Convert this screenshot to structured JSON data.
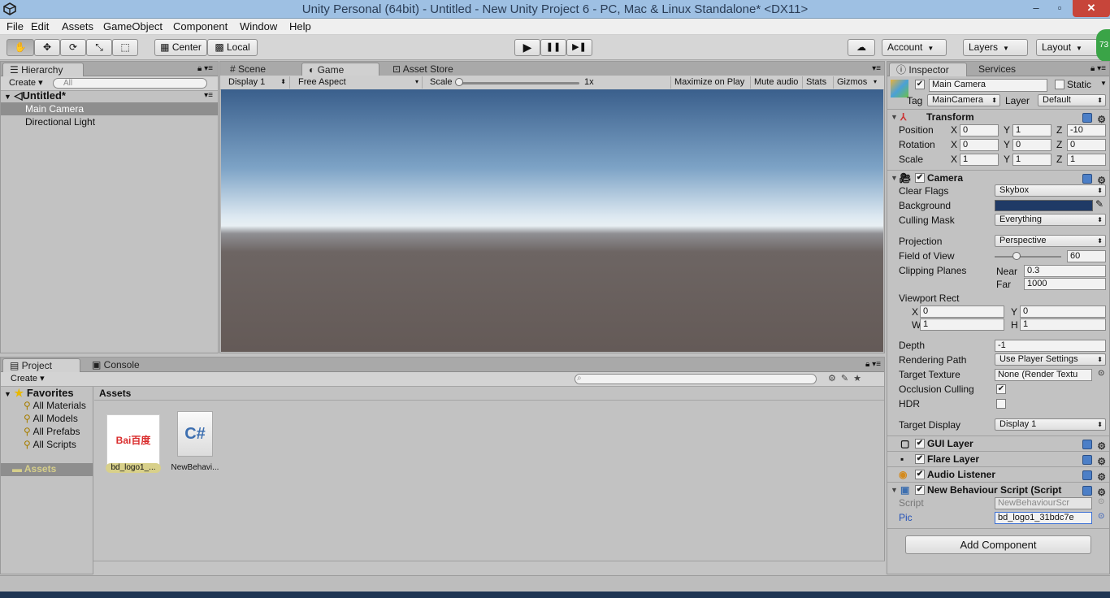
{
  "window": {
    "title": "Unity Personal (64bit) - Untitled - New Unity Project 6 - PC, Mac & Linux Standalone* <DX11>",
    "buttons": [
      "–",
      "▫",
      "✕"
    ]
  },
  "menu": [
    "File",
    "Edit",
    "Assets",
    "GameObject",
    "Component",
    "Window",
    "Help"
  ],
  "toolbar": {
    "transform_tools": [
      "hand-icon",
      "move-icon",
      "rotate-icon",
      "scale-icon",
      "rect-tool-icon"
    ],
    "pivot": "Center",
    "space": "Local",
    "play": "▶",
    "pause": "❚❚",
    "step": "▶❚",
    "account": "Account",
    "layers": "Layers",
    "layout": "Layout",
    "badge": "73"
  },
  "hierarchy": {
    "tab": "Hierarchy",
    "create": "Create",
    "search_placeholder": "All",
    "scene": "Untitled*",
    "items": [
      "Main Camera",
      "Directional Light"
    ],
    "selected": 0
  },
  "center_tabs": [
    "Scene",
    "Game",
    "Asset Store"
  ],
  "game_bar": {
    "display": "Display 1",
    "aspect": "Free Aspect",
    "scale_label": "Scale",
    "scale_value": "1x",
    "maximize": "Maximize on Play",
    "mute": "Mute audio",
    "stats": "Stats",
    "gizmos": "Gizmos"
  },
  "project": {
    "tabs": [
      "Project",
      "Console"
    ],
    "create": "Create",
    "favorites": "Favorites",
    "favorite_items": [
      "All Materials",
      "All Models",
      "All Prefabs",
      "All Scripts"
    ],
    "assets_folder": "Assets",
    "breadcrumb": "Assets",
    "assets": [
      {
        "name": "bd_logo1_...",
        "thumb_text": "Bai百度"
      },
      {
        "name": "NewBehavi...",
        "thumb_text": "C#"
      }
    ]
  },
  "inspector": {
    "tabs": [
      "Inspector",
      "Services"
    ],
    "object_name": "Main Camera",
    "static_label": "Static",
    "tag_label": "Tag",
    "tag_value": "MainCamera",
    "layer_label": "Layer",
    "layer_value": "Default",
    "transform": {
      "title": "Transform",
      "rows": [
        {
          "label": "Position",
          "x": "0",
          "y": "1",
          "z": "-10"
        },
        {
          "label": "Rotation",
          "x": "0",
          "y": "0",
          "z": "0"
        },
        {
          "label": "Scale",
          "x": "1",
          "y": "1",
          "z": "1"
        }
      ]
    },
    "camera": {
      "title": "Camera",
      "clear_flags_label": "Clear Flags",
      "clear_flags": "Skybox",
      "background_label": "Background",
      "background_color": "#1f3a66",
      "culling_mask_label": "Culling Mask",
      "culling_mask": "Everything",
      "projection_label": "Projection",
      "projection": "Perspective",
      "fov_label": "Field of View",
      "fov": "60",
      "fov_slider_fraction": 0.33,
      "clipping_label": "Clipping Planes",
      "near_label": "Near",
      "near": "0.3",
      "far_label": "Far",
      "far": "1000",
      "viewport_label": "Viewport Rect",
      "vx": "0",
      "vy": "0",
      "vw": "1",
      "vh": "1",
      "depth_label": "Depth",
      "depth": "-1",
      "rendering_path_label": "Rendering Path",
      "rendering_path": "Use Player Settings",
      "target_texture_label": "Target Texture",
      "target_texture": "None (Render Textu",
      "occlusion_label": "Occlusion Culling",
      "hdr_label": "HDR",
      "target_display_label": "Target Display",
      "target_display": "Display 1"
    },
    "components": [
      "GUI Layer",
      "Flare Layer",
      "Audio Listener"
    ],
    "script_component": {
      "title": "New Behaviour Script (Script",
      "script_label": "Script",
      "script_value": "NewBehaviourScr",
      "pic_label": "Pic",
      "pic_value": "bd_logo1_31bdc7e"
    },
    "add_component": "Add Component"
  }
}
